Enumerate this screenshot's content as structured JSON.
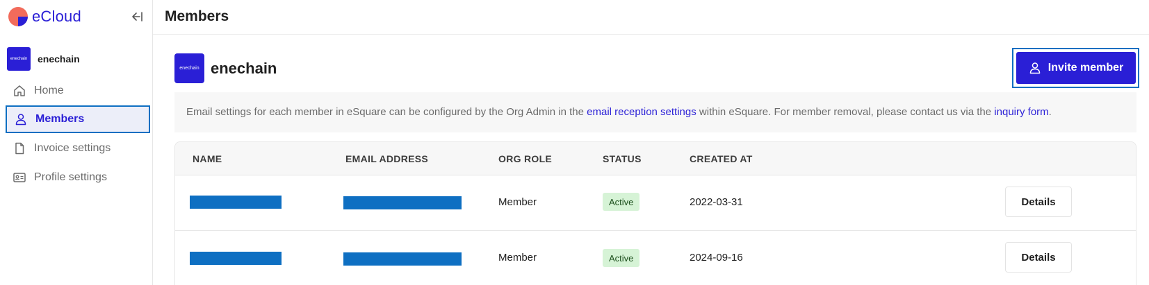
{
  "app": {
    "brand": "eCloud",
    "colors": {
      "accent": "#2a1fd6",
      "logo_red": "#f26b5b",
      "focus": "#0e6fc2",
      "badge_bg": "#d6f3d6"
    }
  },
  "sidebar": {
    "org_name": "enechain",
    "org_logo_text": "enechain",
    "collapse_icon": "collapse-left-icon",
    "items": [
      {
        "label": "Home",
        "icon": "home-icon",
        "active": false
      },
      {
        "label": "Members",
        "icon": "user-icon",
        "active": true
      },
      {
        "label": "Invoice settings",
        "icon": "document-icon",
        "active": false
      },
      {
        "label": "Profile settings",
        "icon": "id-card-icon",
        "active": false
      }
    ]
  },
  "header": {
    "title": "Members"
  },
  "main": {
    "org_name": "enechain",
    "org_logo_text": "enechain",
    "invite_label": "Invite member",
    "notice": {
      "part1": "Email settings for each member in eSquare can be configured by the Org Admin in the ",
      "link1": "email reception settings",
      "part2": " within eSquare. For member removal, please contact us via the ",
      "link2": "inquiry form",
      "part3": "."
    },
    "table": {
      "columns": [
        "NAME",
        "EMAIL ADDRESS",
        "ORG ROLE",
        "STATUS",
        "CREATED AT"
      ],
      "rows": [
        {
          "name": "",
          "email": "",
          "role": "Member",
          "status": "Active",
          "created_at": "2022-03-31",
          "action": "Details"
        },
        {
          "name": "",
          "email": "",
          "role": "Member",
          "status": "Active",
          "created_at": "2024-09-16",
          "action": "Details"
        }
      ]
    }
  }
}
